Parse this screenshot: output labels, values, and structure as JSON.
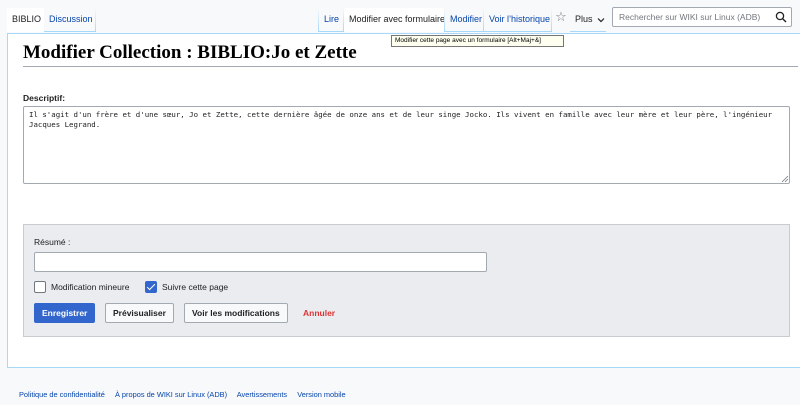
{
  "tabs": {
    "left": [
      {
        "label": "BIBLIO"
      },
      {
        "label": "Discussion"
      }
    ],
    "right": [
      {
        "label": "Lire"
      },
      {
        "label": "Modifier avec formulaire"
      },
      {
        "label": "Modifier"
      },
      {
        "label": "Voir l’historique"
      },
      {
        "label": "Plus"
      }
    ]
  },
  "search": {
    "placeholder": "Rechercher sur WIKI sur Linux (ADB)"
  },
  "tooltip": "Modifier cette page avec un formulaire [Alt+Maj+&]",
  "page": {
    "title": "Modifier Collection : BIBLIO:Jo et Zette",
    "field_label": "Descriptif:",
    "description": "Il s'agit d'un frère et d'une sœur, Jo et Zette, cette dernière âgée de onze ans et de leur singe Jocko. Ils vivent en famille avec leur mère et leur père, l'ingénieur Jacques Legrand."
  },
  "edit_options": {
    "summary_label": "Résumé :",
    "summary_value": "",
    "minor_label": "Modification mineure",
    "minor_checked": false,
    "watch_label": "Suivre cette page",
    "watch_checked": true,
    "save_label": "Enregistrer",
    "preview_label": "Prévisualiser",
    "diff_label": "Voir les modifications",
    "cancel_label": "Annuler"
  },
  "footer": {
    "links": [
      "Politique de confidentialité",
      "À propos de WIKI sur Linux (ADB)",
      "Avertissements",
      "Version mobile"
    ]
  },
  "colors": {
    "link": "#0645ad",
    "primary": "#3366cc",
    "destructive": "#dd3333"
  }
}
